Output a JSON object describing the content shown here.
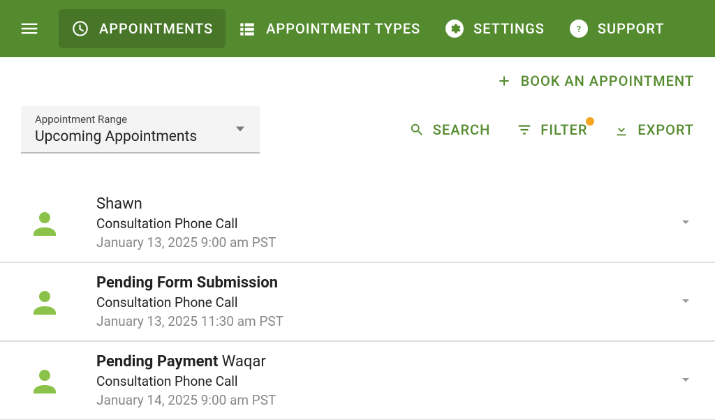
{
  "nav": {
    "appointments": "APPOINTMENTS",
    "appointment_types": "APPOINTMENT TYPES",
    "settings": "SETTINGS",
    "support": "SUPPORT"
  },
  "actions": {
    "book": "BOOK AN APPOINTMENT"
  },
  "range_select": {
    "label": "Appointment Range",
    "value": "Upcoming Appointments"
  },
  "controls": {
    "search": "SEARCH",
    "filter": "FILTER",
    "export": "EXPORT",
    "filter_has_badge": true
  },
  "appointments": [
    {
      "status_prefix": "",
      "name": "Shawn",
      "type": "Consultation Phone Call",
      "datetime": "January 13, 2025 9:00 am PST"
    },
    {
      "status_prefix": "Pending Form Submission",
      "name": "",
      "type": "Consultation Phone Call",
      "datetime": "January 13, 2025 11:30 am PST"
    },
    {
      "status_prefix": "Pending Payment",
      "name": "Waqar",
      "type": "Consultation Phone Call",
      "datetime": "January 14, 2025 9:00 am PST"
    }
  ]
}
